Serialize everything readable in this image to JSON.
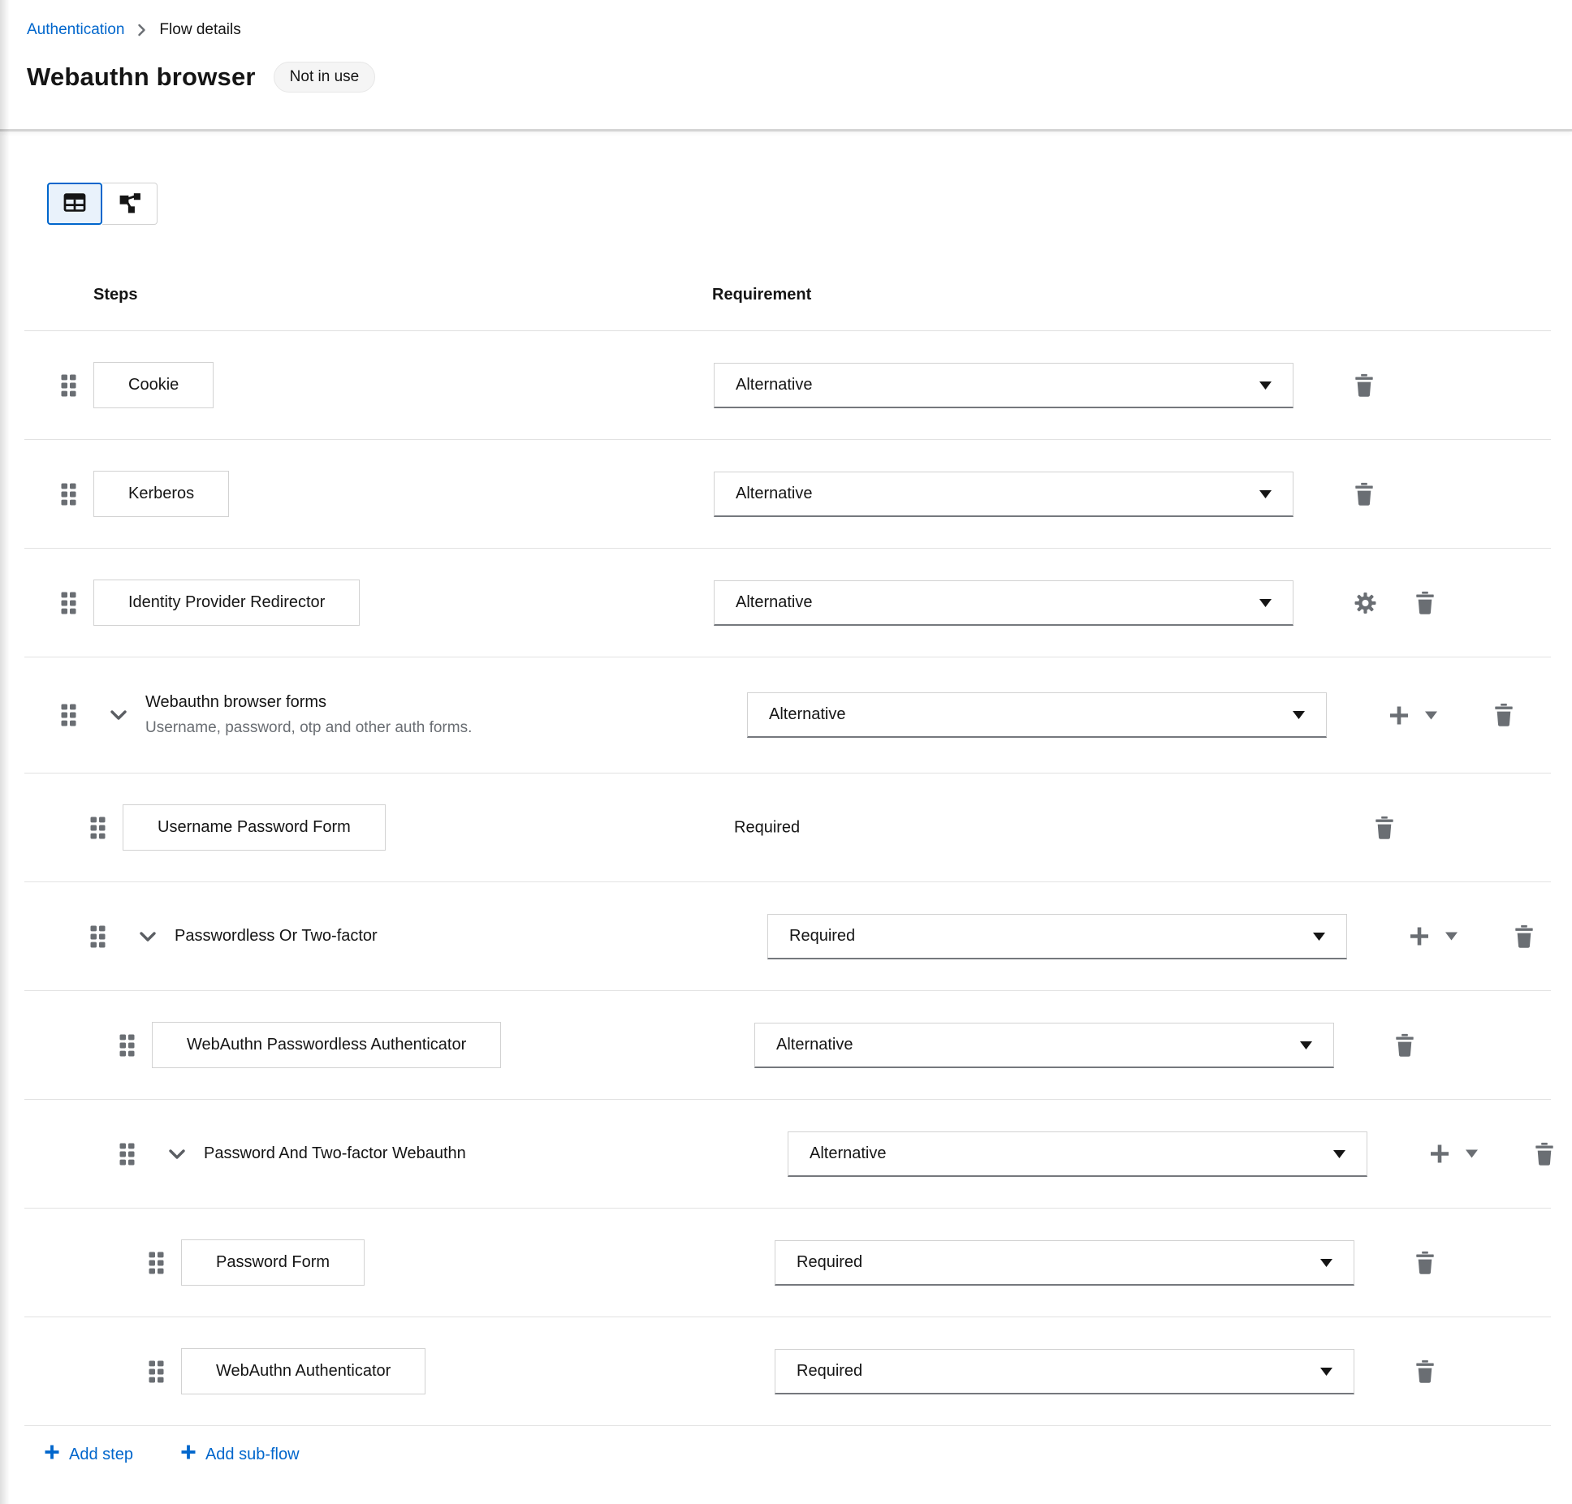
{
  "breadcrumb": {
    "link": "Authentication",
    "current": "Flow details"
  },
  "header": {
    "title": "Webauthn browser",
    "badge": "Not in use"
  },
  "toolbar": {
    "view_toggle": [
      {
        "icon": "table-view-icon",
        "selected": true
      },
      {
        "icon": "diagram-view-icon",
        "selected": false
      }
    ]
  },
  "table": {
    "columns": [
      "Steps",
      "Requirement"
    ]
  },
  "rows": [
    {
      "kind": "step",
      "level": 0,
      "name": "Cookie",
      "requirement": "Alternative",
      "control": "dropdown",
      "actions": [
        "trash"
      ]
    },
    {
      "kind": "step",
      "level": 0,
      "name": "Kerberos",
      "requirement": "Alternative",
      "control": "dropdown",
      "actions": [
        "trash"
      ]
    },
    {
      "kind": "step",
      "level": 0,
      "name": "Identity Provider Redirector",
      "requirement": "Alternative",
      "control": "dropdown",
      "actions": [
        "gear",
        "trash"
      ]
    },
    {
      "kind": "subflow",
      "level": 0,
      "name": "Webauthn browser forms",
      "description": "Username, password, otp and other auth forms.",
      "requirement": "Alternative",
      "control": "dropdown",
      "actions": [
        "plus",
        "caret",
        "trash"
      ]
    },
    {
      "kind": "step",
      "level": 1,
      "name": "Username Password Form",
      "requirement": "Required",
      "control": "text",
      "actions": [
        "trash"
      ]
    },
    {
      "kind": "subflow",
      "level": 1,
      "name": "Passwordless Or Two-factor",
      "requirement": "Required",
      "control": "dropdown",
      "actions": [
        "plus",
        "caret",
        "trash"
      ]
    },
    {
      "kind": "step",
      "level": 2,
      "name": "WebAuthn Passwordless Authenticator",
      "requirement": "Alternative",
      "control": "dropdown",
      "actions": [
        "trash"
      ]
    },
    {
      "kind": "subflow",
      "level": 2,
      "name": "Password And Two-factor Webauthn",
      "requirement": "Alternative",
      "control": "dropdown",
      "actions": [
        "plus",
        "caret",
        "trash"
      ]
    },
    {
      "kind": "step",
      "level": 3,
      "name": "Password Form",
      "requirement": "Required",
      "control": "dropdown",
      "actions": [
        "trash"
      ]
    },
    {
      "kind": "step",
      "level": 3,
      "name": "WebAuthn Authenticator",
      "requirement": "Required",
      "control": "dropdown",
      "actions": [
        "trash"
      ]
    }
  ],
  "footer": {
    "add_step": "Add step",
    "add_subflow": "Add sub-flow"
  },
  "ui_colors": {
    "link_blue": "#0066cc",
    "icon_gray": "#6a6e73",
    "text": "#151515",
    "border": "#d2d2d2"
  }
}
